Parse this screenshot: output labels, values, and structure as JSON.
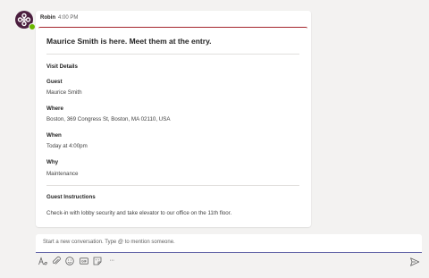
{
  "message": {
    "sender": "Robin",
    "time": "4:00 PM",
    "avatar_icon": "robin-logo-icon",
    "presence_color": "#6bb700"
  },
  "card": {
    "title": "Maurice Smith is here. Meet them at the entry.",
    "accent_color": "#a4262c",
    "visit_details_heading": "Visit Details",
    "guest_label": "Guest",
    "guest_value": "Maurice Smith",
    "where_label": "Where",
    "where_value": "Boston, 369 Congress St, Boston, MA 02110, USA",
    "when_label": "When",
    "when_value": "Today at 4:00pm",
    "why_label": "Why",
    "why_value": "Maintenance",
    "instructions_heading": "Guest Instructions",
    "instructions_value": "Check-in with lobby security and take elevator to our office on the 11th floor."
  },
  "compose": {
    "placeholder": "Start a new conversation. Type @ to mention someone.",
    "accent_color": "#6264a7"
  },
  "toolbar": {
    "icons": [
      "format-icon",
      "attach-icon",
      "emoji-icon",
      "gif-icon",
      "sticker-icon",
      "more-options-icon"
    ],
    "more_label": "···",
    "send_icon": "send-icon"
  }
}
